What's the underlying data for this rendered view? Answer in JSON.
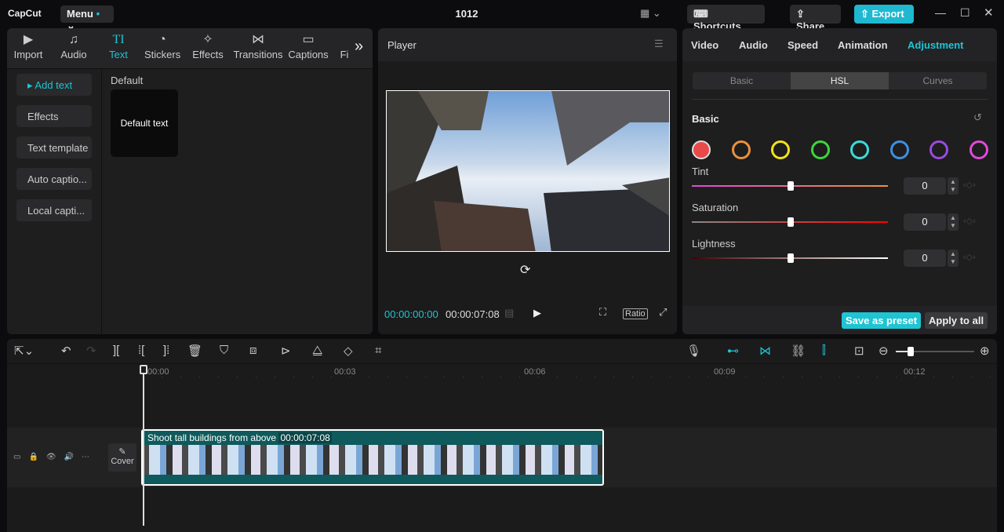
{
  "app": {
    "logo": "CapCut",
    "menu": "Menu",
    "title": "1012",
    "shortcuts": "Shortcuts",
    "share": "Share",
    "export": "Export"
  },
  "media_tabs": [
    {
      "label": "Import",
      "icon": "▶"
    },
    {
      "label": "Audio",
      "icon": "♫"
    },
    {
      "label": "Text",
      "icon": "TI"
    },
    {
      "label": "Stickers",
      "icon": "◔"
    },
    {
      "label": "Effects",
      "icon": "✧"
    },
    {
      "label": "Transitions",
      "icon": "⋈"
    },
    {
      "label": "Captions",
      "icon": "▭"
    },
    {
      "label": "Fi",
      "icon": ""
    }
  ],
  "text_sidebar": [
    "Add text",
    "Effects",
    "Text template",
    "Auto captio...",
    "Local capti..."
  ],
  "text_panel": {
    "section": "Default",
    "card": "Default text"
  },
  "player": {
    "title": "Player",
    "current_time": "00:00:00:00",
    "total_time": "00:00:07:08",
    "ratio": "Ratio"
  },
  "right_tabs": [
    "Video",
    "Audio",
    "Speed",
    "Animation",
    "Adjustment"
  ],
  "right_active": "Adjustment",
  "sub_tabs": [
    "Basic",
    "HSL",
    "Curves"
  ],
  "hsl": {
    "section": "Basic",
    "colors": [
      "#e84a4a",
      "#e8913f",
      "#f2e21a",
      "#3ed43e",
      "#3adbdb",
      "#3f8fe0",
      "#9b4ae0",
      "#e04ad9"
    ],
    "sliders": [
      {
        "label": "Tint",
        "value": "0"
      },
      {
        "label": "Saturation",
        "value": "0"
      },
      {
        "label": "Lightness",
        "value": "0"
      }
    ]
  },
  "right_footer": {
    "save_preset": "Save as preset",
    "apply_all": "Apply to all"
  },
  "timeline": {
    "ruler": [
      "00:00",
      "00:03",
      "00:06",
      "00:09",
      "00:12"
    ],
    "clip_title": "Shoot tall buildings from above",
    "clip_duration": "00:00:07:08",
    "cover": "Cover"
  }
}
